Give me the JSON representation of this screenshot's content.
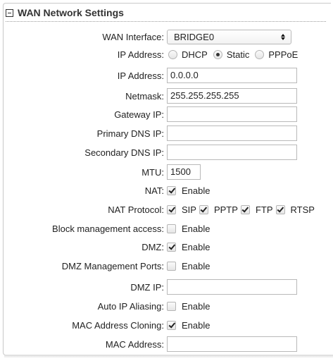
{
  "panel": {
    "title": "WAN Network Settings"
  },
  "wan_interface": {
    "label": "WAN Interface:",
    "value": "BRIDGE0"
  },
  "ip_mode": {
    "label": "IP Address:",
    "options": [
      {
        "label": "DHCP",
        "checked": false
      },
      {
        "label": "Static",
        "checked": true
      },
      {
        "label": "PPPoE",
        "checked": false
      }
    ]
  },
  "ip_address": {
    "label": "IP Address:",
    "value": "0.0.0.0"
  },
  "netmask": {
    "label": "Netmask:",
    "value": "255.255.255.255"
  },
  "gateway_ip": {
    "label": "Gateway IP:",
    "value": ""
  },
  "primary_dns": {
    "label": "Primary DNS IP:",
    "value": ""
  },
  "secondary_dns": {
    "label": "Secondary DNS IP:",
    "value": ""
  },
  "mtu": {
    "label": "MTU:",
    "value": "1500"
  },
  "nat": {
    "label": "NAT:",
    "option": "Enable",
    "checked": true
  },
  "nat_protocol": {
    "label": "NAT Protocol:",
    "options": [
      {
        "label": "SIP",
        "checked": true
      },
      {
        "label": "PPTP",
        "checked": true
      },
      {
        "label": "FTP",
        "checked": true
      },
      {
        "label": "RTSP",
        "checked": true
      }
    ]
  },
  "block_management": {
    "label": "Block management access:",
    "option": "Enable",
    "checked": false
  },
  "dmz": {
    "label": "DMZ:",
    "option": "Enable",
    "checked": true
  },
  "dmz_management_ports": {
    "label": "DMZ Management Ports:",
    "option": "Enable",
    "checked": false
  },
  "dmz_ip": {
    "label": "DMZ IP:",
    "value": ""
  },
  "auto_ip_aliasing": {
    "label": "Auto IP Aliasing:",
    "option": "Enable",
    "checked": false
  },
  "mac_cloning": {
    "label": "MAC Address Cloning:",
    "option": "Enable",
    "checked": true
  },
  "mac_address": {
    "label": "MAC Address:",
    "value": ""
  }
}
